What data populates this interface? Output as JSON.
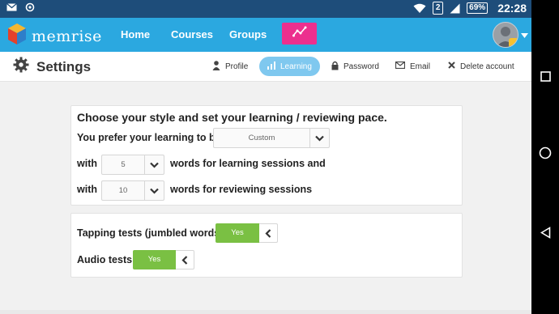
{
  "status_bar": {
    "sim_number": "2",
    "battery": "69%",
    "time": "22:28"
  },
  "app": {
    "logo_text": "memrise",
    "nav": {
      "home": "Home",
      "courses": "Courses",
      "groups": "Groups"
    }
  },
  "settings": {
    "title": "Settings",
    "tabs": {
      "profile": "Profile",
      "learning": "Learning",
      "password": "Password",
      "email": "Email",
      "delete_account": "Delete account"
    }
  },
  "pace": {
    "heading": "Choose your style and set your learning / reviewing pace.",
    "prefer_label": "You prefer your learning to be",
    "style_value": "Custom",
    "with_label": "with",
    "learning_words": "5",
    "learning_suffix": "words for learning sessions and",
    "reviewing_words": "10",
    "reviewing_suffix": "words for reviewing sessions"
  },
  "tests": {
    "tapping_label": "Tapping tests (jumbled words)",
    "tapping_value": "Yes",
    "audio_label": "Audio tests",
    "audio_value": "Yes"
  },
  "colors": {
    "status_bar": "#1e4d7a",
    "header": "#2ba8e0",
    "stats_button": "#ec2f8e",
    "active_tab": "#7fc8ef",
    "toggle_yes": "#7ac043"
  }
}
